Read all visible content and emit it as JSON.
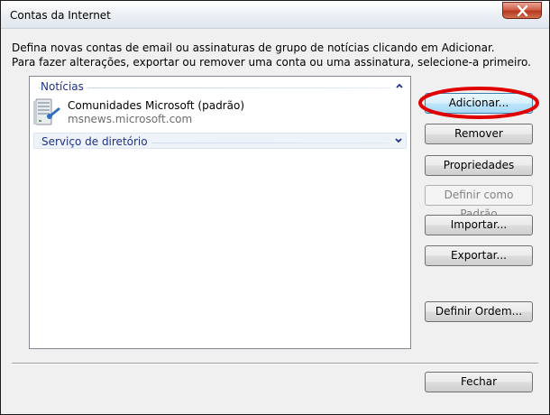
{
  "window": {
    "title": "Contas da Internet",
    "close_icon": "close-icon"
  },
  "intro": {
    "line1": "Defina novas contas de email ou assinaturas de grupo de notícias clicando em Adicionar.",
    "line2": "Para fazer alterações, exportar ou remover uma conta ou uma assinatura, selecione-a primeiro."
  },
  "accounts_list": {
    "groups": [
      {
        "label": "Notícias",
        "state": "expanded",
        "items": [
          {
            "name": "Comunidades Microsoft (padrão)",
            "server": "msnews.microsoft.com",
            "icon": "news-server-icon"
          }
        ]
      },
      {
        "label": "Serviço de diretório",
        "state": "collapsed",
        "items": []
      }
    ]
  },
  "buttons": {
    "add": "Adicionar...",
    "remove": "Remover",
    "properties": "Propriedades",
    "set_default": "Definir como Padrão",
    "import": "Importar...",
    "export": "Exportar...",
    "set_order": "Definir Ordem...",
    "close": "Fechar"
  },
  "colors": {
    "group_header_text": "#1e3287",
    "highlight_annotation": "#e00000",
    "close_button": "#c8432a"
  }
}
